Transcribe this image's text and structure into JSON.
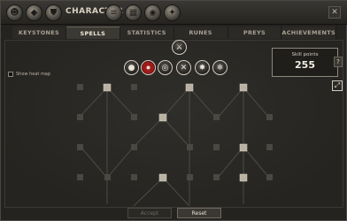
{
  "header": {
    "title": "CHARACTER",
    "icons": [
      "character-portrait-icon",
      "bag-icon",
      "shield-icon",
      "scroll-icon",
      "eye-icon",
      "settings-icon"
    ]
  },
  "tabs": [
    {
      "label": "KEYSTONES",
      "active": false
    },
    {
      "label": "SPELLS",
      "active": true
    },
    {
      "label": "STATISTICS",
      "active": false
    },
    {
      "label": "RUNES",
      "active": false
    },
    {
      "label": "PREYS",
      "active": false
    },
    {
      "label": "ACHIEVEMENTS",
      "active": false
    }
  ],
  "spells": {
    "top_icon": "tree-root-icon",
    "items": [
      {
        "name": "void-spell-icon",
        "selected": false
      },
      {
        "name": "blood-spell-icon",
        "selected": true
      },
      {
        "name": "target-spell-icon",
        "selected": false
      },
      {
        "name": "cross-spell-icon",
        "selected": false
      },
      {
        "name": "burst-spell-icon",
        "selected": false
      },
      {
        "name": "frost-spell-icon",
        "selected": false
      }
    ]
  },
  "skill_points": {
    "label": "Skill points",
    "value": "255"
  },
  "help_label": "?",
  "show_heat_map": {
    "label": "Show heat map",
    "checked": false
  },
  "buttons": {
    "accept": "Accept",
    "reset": "Reset"
  },
  "colors": {
    "accent_red": "#a11a1a",
    "panel_bg": "#242320",
    "node_faded": "#4a4843"
  }
}
